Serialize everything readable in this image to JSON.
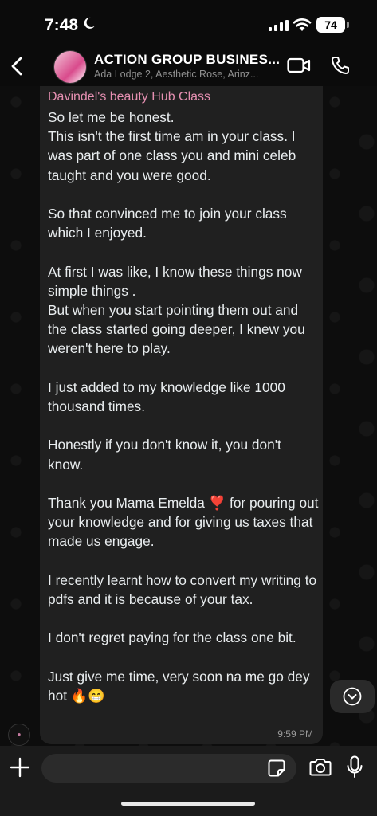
{
  "status": {
    "time": "7:48",
    "battery": "74"
  },
  "header": {
    "title": "ACTION GROUP BUSINES...",
    "subtitle": "Ada Lodge 2, Aesthetic Rose, Arinz..."
  },
  "message": {
    "sender": "Davindel's beauty Hub Class",
    "text": "So let me be honest.\nThis isn't the first time am in your class. I was part of one class you and mini celeb taught and you were good.\n\nSo that convinced me to join your class which I enjoyed.\n\nAt first I was like, I know these things now simple things .\nBut when you start pointing them out and the class started going deeper, I knew you weren't here to play.\n\nI just added to my knowledge like 1000 thousand times.\n\nHonestly if you don't know it, you don't know.\n\nThank you Mama Emelda ❣️ for pouring out your knowledge and for giving us taxes that made us engage.\n\nI recently learnt how to convert my writing to pdfs and it is because of your tax.\n\nI don't regret paying for the class one bit.\n\nJust give me time, very soon na me go dey hot 🔥😁",
    "time": "9:59 PM"
  },
  "colors": {
    "sender": "#e58fb1",
    "bubble": "#202020",
    "background": "#0b0b0b"
  },
  "icons": [
    "back-icon",
    "video-call-icon",
    "phone-icon",
    "scroll-down-icon",
    "plus-icon",
    "sticker-icon",
    "camera-icon",
    "mic-icon"
  ]
}
